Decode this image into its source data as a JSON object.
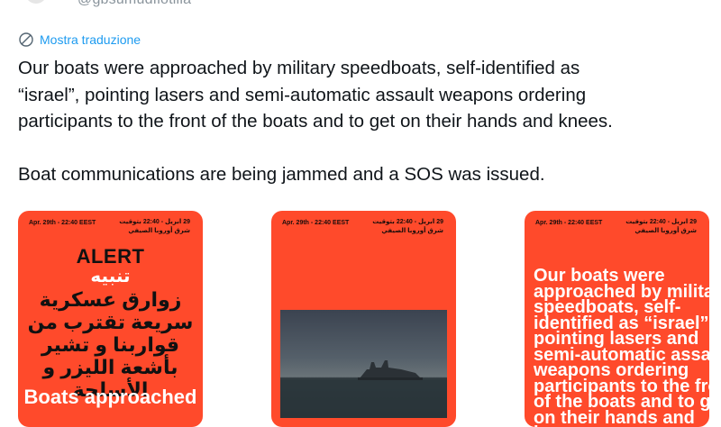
{
  "header": {
    "handle": "@gbsumudflotilla"
  },
  "translate": {
    "icon": "globe-icon",
    "label": "Mostra traduzione"
  },
  "tweet": {
    "text": "Our boats were approached by military speedboats, self-identified as\n“israel”, pointing lasers and semi-automatic assault weapons ordering\nparticipants to the front of the boats and to get on their hands and knees.\n\nBoat communications are being jammed and a SOS was issued."
  },
  "cards": [
    {
      "date_en": "Apr. 29th - 22:40 EEST",
      "date_ar_line1": "29 ابريل - 22:40 بتوقيت",
      "date_ar_line2": "شرق أوروبا الصيفي",
      "alert": "ALERT",
      "alert_ar": "تنبيه",
      "body_ar": "زوارق عسكرية سريعة تقترب من قواربنا و تشير بأشعة الليزر و الأسلحة",
      "footer_en": "Boats approached"
    },
    {
      "date_en": "Apr. 29th - 22:40 EEST",
      "date_ar_line1": "29 ابريل - 22:40 بتوقيت",
      "date_ar_line2": "شرق أوروبا الصيفي",
      "image": "warship-at-night-photo"
    },
    {
      "date_en": "Apr. 29th - 22:40 EEST",
      "date_ar_line1": "29 ابريل - 22:40 بتوقيت",
      "date_ar_line2": "شرق أوروبا الصيفي",
      "body_en": "Our boats were approached by military speedboats, self-identified as “israel”, pointing lasers and semi-automatic assault weapons ordering participants to the front of the boats and to get on their hands and knees"
    }
  ],
  "colors": {
    "accent": "#1d9bf0",
    "card_bg": "#ff4a2b",
    "text": "#0f1419"
  }
}
